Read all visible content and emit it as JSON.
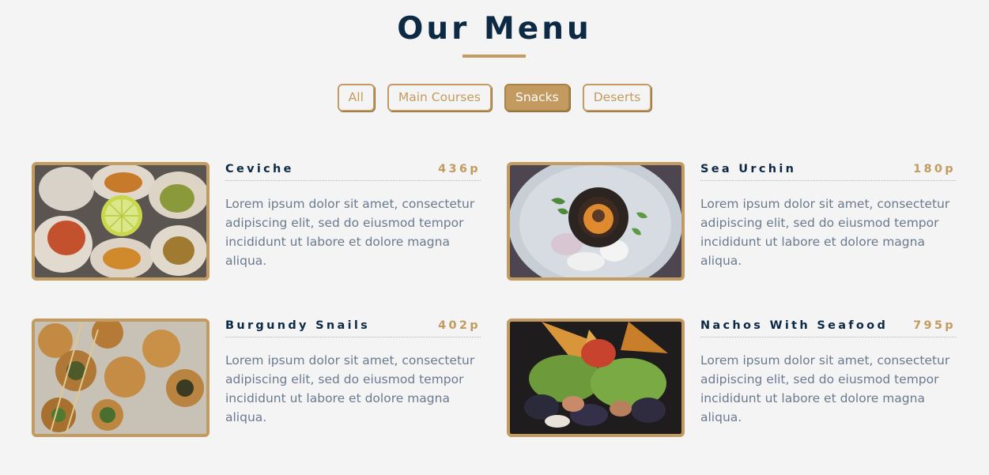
{
  "section": {
    "title": "Our Menu"
  },
  "filters": [
    {
      "label": "All",
      "active": false
    },
    {
      "label": "Main Courses",
      "active": false
    },
    {
      "label": "Snacks",
      "active": true
    },
    {
      "label": "Deserts",
      "active": false
    }
  ],
  "items": [
    {
      "name": "Ceviche",
      "price": "436p",
      "description": "Lorem ipsum dolor sit amet, consectetur adipiscing elit, sed do eiusmod tempor incididunt ut labore et dolore magna aliqua."
    },
    {
      "name": "Sea Urchin",
      "price": "180p",
      "description": "Lorem ipsum dolor sit amet, consectetur adipiscing elit, sed do eiusmod tempor incididunt ut labore et dolore magna aliqua."
    },
    {
      "name": "Burgundy Snails",
      "price": "402p",
      "description": "Lorem ipsum dolor sit amet, consectetur adipiscing elit, sed do eiusmod tempor incididunt ut labore et dolore magna aliqua."
    },
    {
      "name": "Nachos With Seafood",
      "price": "795p",
      "description": "Lorem ipsum dolor sit amet, consectetur adipiscing elit, sed do eiusmod tempor incididunt ut labore et dolore magna aliqua."
    }
  ],
  "colors": {
    "accent": "#c39b60",
    "heading": "#0d2a45",
    "text": "#6a7a8e",
    "background": "#f4f4f4"
  }
}
